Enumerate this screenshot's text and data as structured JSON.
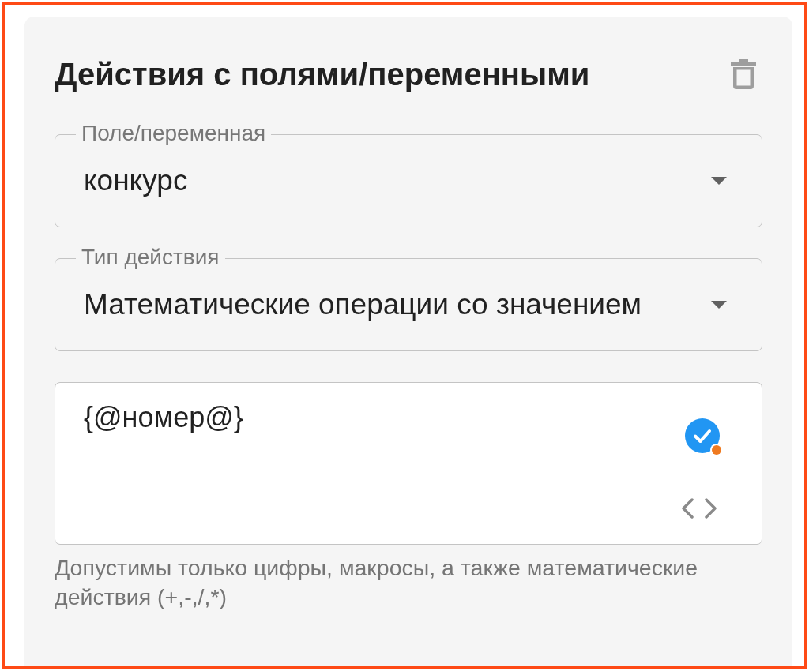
{
  "panel": {
    "title": "Действия с полями/переменными"
  },
  "fields": [
    {
      "kind": "dropdown",
      "label": "Поле/переменная",
      "value": "конкурс"
    },
    {
      "kind": "dropdown",
      "label": "Тип действия",
      "value": "Математические операции со значением"
    },
    {
      "kind": "textarea",
      "value": "{@номер@}",
      "helper_text": "Допустимы только цифры, макросы, а также математические действия (+,-,/,*)"
    }
  ]
}
